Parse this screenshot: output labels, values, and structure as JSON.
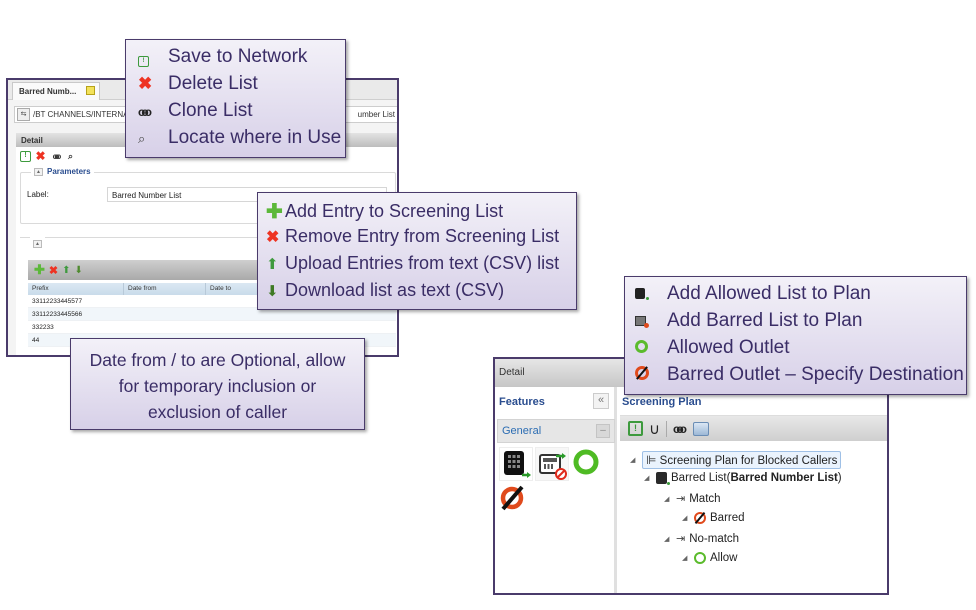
{
  "left_window": {
    "tab_label": "Barred Numb...",
    "path_text": "/BT CHANNELS/INTERNA",
    "path_right_text": "umber List",
    "detail_title": "Detail",
    "toolbar_icons": [
      "save-icon",
      "delete-icon",
      "clone-icon",
      "locate-icon"
    ],
    "parameters_legend": "Parameters",
    "label_caption": "Label:",
    "label_value": "Barred Number List",
    "grid_toolbar_icons": [
      "add-icon",
      "remove-icon",
      "upload-icon",
      "download-icon"
    ],
    "grid_columns": [
      "Prefix",
      "Date from",
      "Date to"
    ],
    "grid_rows": [
      {
        "prefix": "33112233445577",
        "date_from": "",
        "date_to": ""
      },
      {
        "prefix": "33112233445566",
        "date_from": "",
        "date_to": ""
      },
      {
        "prefix": "332233",
        "date_from": "",
        "date_to": ""
      },
      {
        "prefix": "44",
        "date_from": "",
        "date_to": ""
      }
    ]
  },
  "callout_list_actions": {
    "items": [
      {
        "icon": "save-network-icon",
        "label": "Save to Network"
      },
      {
        "icon": "delete-icon",
        "label": "Delete List"
      },
      {
        "icon": "clone-icon",
        "label": "Clone List"
      },
      {
        "icon": "locate-icon",
        "label": "Locate where in Use"
      }
    ]
  },
  "callout_entry_actions": {
    "items": [
      {
        "icon": "add-icon",
        "label": "Add Entry to Screening List"
      },
      {
        "icon": "remove-icon",
        "label": "Remove Entry from Screening List"
      },
      {
        "icon": "upload-icon",
        "label": "Upload Entries from text (CSV) list"
      },
      {
        "icon": "download-icon",
        "label": "Download list as text (CSV)"
      }
    ]
  },
  "callout_dates": {
    "line1": "Date from / to are Optional, allow",
    "line2": "for temporary inclusion or",
    "line3": "exclusion of caller"
  },
  "callout_plan_items": {
    "items": [
      {
        "icon": "allowed-list-icon",
        "label": "Add Allowed List to Plan"
      },
      {
        "icon": "barred-list-icon",
        "label": "Add Barred List to Plan"
      },
      {
        "icon": "allowed-outlet-icon",
        "label": "Allowed Outlet"
      },
      {
        "icon": "barred-outlet-icon",
        "label": "Barred Outlet – Specify Destination"
      }
    ]
  },
  "right_window": {
    "detail_title": "Detail",
    "features_title": "Features",
    "collapse_glyph": "«",
    "general_label": "General",
    "general_toggle": "–",
    "plan_title": "Screening Plan",
    "tree": {
      "root": "Screening Plan for Blocked Callers",
      "list_prefix": "Barred List(",
      "list_name": "Barred Number List",
      "list_suffix": ")",
      "match": "Match",
      "barred": "Barred",
      "nomatch": "No-match",
      "allow": "Allow"
    }
  }
}
